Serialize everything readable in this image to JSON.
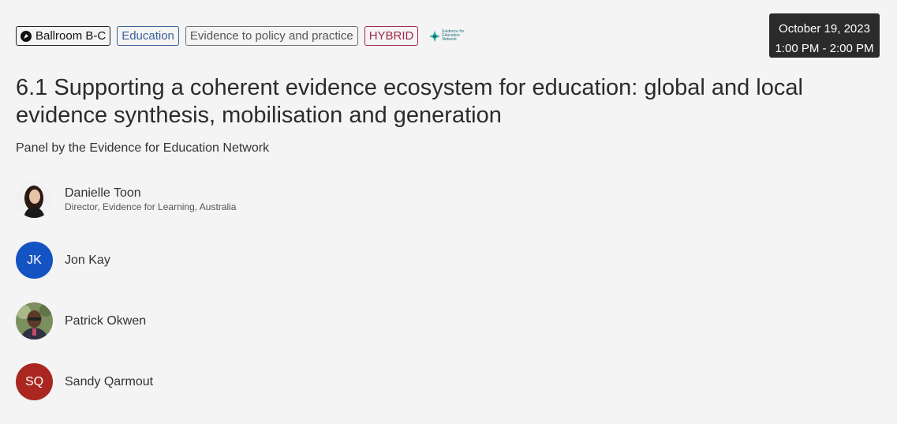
{
  "tags": {
    "location": "Ballroom B-C",
    "category": "Education",
    "track": "Evidence to policy and practice",
    "format": "HYBRID",
    "sponsor_logo_text": "Evidence for Education Network"
  },
  "datetime": {
    "date": "October 19, 2023",
    "time": "1:00 PM - 2:00 PM"
  },
  "session": {
    "title": "6.1 Supporting a coherent evidence ecosystem for education: global and local evidence synthesis, mobilisation and generation",
    "subtitle": "Panel by the Evidence for Education Network"
  },
  "speakers": [
    {
      "name": "Danielle Toon",
      "role": "Director, Evidence for Learning, Australia",
      "initials": ""
    },
    {
      "name": "Jon Kay",
      "role": "",
      "initials": "JK"
    },
    {
      "name": "Patrick Okwen",
      "role": "",
      "initials": ""
    },
    {
      "name": "Sandy Qarmout",
      "role": "",
      "initials": "SQ"
    }
  ],
  "colors": {
    "background": "#f4f4f4",
    "education_tag": "#3a5f99",
    "hybrid_tag": "#a0284a",
    "datetime_bg": "#2b2b2b",
    "avatar_jk": "#1453c2",
    "avatar_sq": "#a92720"
  }
}
